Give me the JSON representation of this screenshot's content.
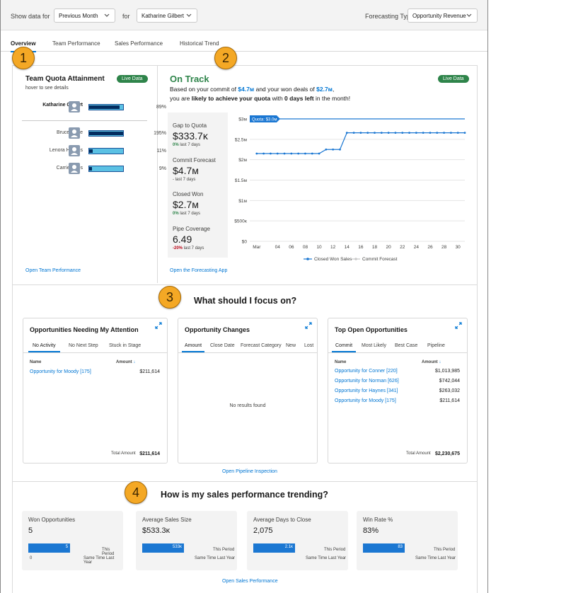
{
  "filters": {
    "show_label": "Show data for",
    "period_value": "Previous Month",
    "for_label": "for",
    "person_value": "Katharine Gilbert",
    "forecast_label": "Forecasting Type",
    "forecast_value": "Opportunity Revenue"
  },
  "tabs": [
    "Overview",
    "Team Performance",
    "Sales Performance",
    "Historical Trend"
  ],
  "callouts": [
    "1",
    "2",
    "3",
    "4"
  ],
  "quota": {
    "title": "Team Quota Attainment",
    "live": "Live Data",
    "hint": "hover to see details",
    "rows": [
      {
        "name": "Katharine Gilbert",
        "pct": "89%",
        "fill": 0.89
      },
      {
        "name": "Bruce Lowe",
        "pct": "195%",
        "fill": 1.0
      },
      {
        "name": "Lenora Higgins",
        "pct": "11%",
        "fill": 0.11
      },
      {
        "name": "Carrie Miles",
        "pct": "9%",
        "fill": 0.09
      }
    ],
    "link": "Open Team Performance"
  },
  "forecast": {
    "status": "On Track",
    "live": "Live Data",
    "line1_a": "Based on your commit of ",
    "line1_b": "$4.7м",
    "line1_c": " and your won deals of ",
    "line1_d": "$2.7м",
    "line1_e": ",",
    "line2_a": "you are ",
    "line2_b": "likely to achieve your quota",
    "line2_c": " with ",
    "line2_d": "0 days left",
    "line2_e": " in the month!",
    "metrics": [
      {
        "label": "Gap to Quota",
        "value": "$333.7ĸ",
        "delta": "0%",
        "sub": " last 7 days",
        "tone": "pos"
      },
      {
        "label": "Commit Forecast",
        "value": "$4.7м",
        "delta": "",
        "sub": "- last 7 days",
        "tone": ""
      },
      {
        "label": "Closed Won",
        "value": "$2.7м",
        "delta": "0%",
        "sub": " last 7 days",
        "tone": "pos"
      },
      {
        "label": "Pipe Coverage",
        "value": "6.49",
        "delta": "-20%",
        "sub": " last 7 days",
        "tone": "neg"
      }
    ],
    "link": "Open the Forecasting App"
  },
  "chart_data": {
    "type": "line",
    "quota_label": "Quota: $3.0м",
    "quota_value": 3000000,
    "y_ticks": [
      0,
      500000,
      1000000,
      1500000,
      2000000,
      2500000,
      3000000
    ],
    "y_tick_labels": [
      "$0",
      "$500ĸ",
      "$1м",
      "$1.5м",
      "$2м",
      "$2.5м",
      "$3м"
    ],
    "ylim": [
      0,
      3000000
    ],
    "x_ticks": [
      1,
      4,
      6,
      8,
      10,
      12,
      14,
      16,
      18,
      20,
      22,
      24,
      26,
      28,
      30
    ],
    "x_tick_labels": [
      "Mar",
      "04",
      "06",
      "08",
      "10",
      "12",
      "14",
      "16",
      "18",
      "20",
      "22",
      "24",
      "26",
      "28",
      "30"
    ],
    "xlim": [
      0,
      31
    ],
    "series": [
      {
        "name": "Closed Won Sales",
        "color": "#1b77d2",
        "x": [
          1,
          2,
          3,
          4,
          5,
          6,
          7,
          8,
          9,
          10,
          11,
          12,
          13,
          14,
          15,
          16,
          17,
          18,
          19,
          20,
          21,
          22,
          23,
          24,
          25,
          26,
          27,
          28,
          29,
          30,
          31
        ],
        "values": [
          2150000,
          2150000,
          2150000,
          2150000,
          2150000,
          2150000,
          2150000,
          2150000,
          2150000,
          2150000,
          2250000,
          2250000,
          2250000,
          2660000,
          2660000,
          2660000,
          2660000,
          2660000,
          2660000,
          2660000,
          2660000,
          2660000,
          2660000,
          2660000,
          2660000,
          2660000,
          2660000,
          2660000,
          2660000,
          2660000,
          2660000
        ]
      },
      {
        "name": "Commit Forecast",
        "color": "#c9c9c9",
        "x": [],
        "values": []
      }
    ]
  },
  "focus": {
    "title": "What should I focus on?",
    "cards": [
      {
        "title": "Opportunities Needing My Attention",
        "tabs": [
          "No Activity",
          "No Next Step",
          "Stuck in Stage"
        ],
        "col_name": "Name",
        "col_amount": "Amount",
        "rows": [
          {
            "name": "Opportunity for Moody [175]",
            "amount": "$211,614"
          }
        ],
        "total_label": "Total Amount",
        "total": "$211,614"
      },
      {
        "title": "Opportunity Changes",
        "tabs": [
          "Amount",
          "Close Date",
          "Forecast Category",
          "New",
          "Lost"
        ],
        "empty": "No results found"
      },
      {
        "title": "Top Open Opportunities",
        "tabs": [
          "Commit",
          "Most Likely",
          "Best Case",
          "Pipeline"
        ],
        "col_name": "Name",
        "col_amount": "Amount",
        "rows": [
          {
            "name": "Opportunity for Conner [220]",
            "amount": "$1,013,985"
          },
          {
            "name": "Opportunity for Norman [626]",
            "amount": "$742,044"
          },
          {
            "name": "Opportunity for Haynes [341]",
            "amount": "$263,032"
          },
          {
            "name": "Opportunity for Moody [175]",
            "amount": "$211,614"
          }
        ],
        "total_label": "Total Amount",
        "total": "$2,230,675"
      }
    ],
    "link": "Open Pipeline Inspection"
  },
  "trend": {
    "title": "How is my sales performance trending?",
    "this_period": "This Period",
    "last_year": "Same Time Last Year",
    "cards": [
      {
        "label": "Won Opportunities",
        "value": "5",
        "bar_value": "5",
        "bar_fill": 0.82,
        "last_year_value": "0"
      },
      {
        "label": "Average Sales Size",
        "value": "$533.3ĸ",
        "bar_value": "533ĸ",
        "bar_fill": 0.82,
        "last_year_value": ""
      },
      {
        "label": "Average Days to Close",
        "value": "2,075",
        "bar_value": "2.1ĸ",
        "bar_fill": 0.82,
        "last_year_value": ""
      },
      {
        "label": "Win Rate %",
        "value": "83%",
        "bar_value": "83",
        "bar_fill": 0.82,
        "last_year_value": ""
      }
    ],
    "link": "Open Sales Performance"
  }
}
